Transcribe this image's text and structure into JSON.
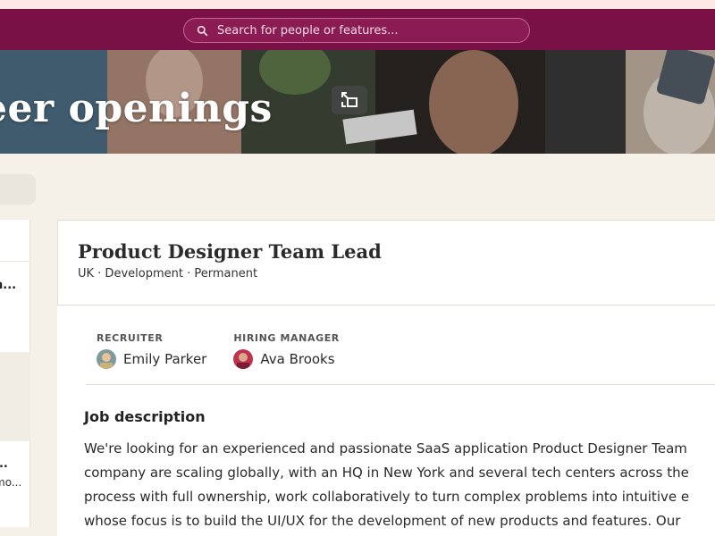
{
  "search": {
    "placeholder": "Search for people or features..."
  },
  "hero": {
    "title": "eer openings"
  },
  "left_list": {
    "items": [
      {
        "title": "t",
        "subtitle": ""
      },
      {
        "title": "n...",
        "subtitle": ""
      },
      {
        "title": "...",
        "subtitle": "mo..."
      }
    ]
  },
  "job": {
    "title": "Product Designer Team Lead",
    "meta": "UK · Development · Permanent",
    "recruiter_label": "RECRUITER",
    "recruiter_name": "Emily Parker",
    "hiring_manager_label": "HIRING MANAGER",
    "hiring_manager_name": "Ava Brooks",
    "description_heading": "Job description",
    "description_lines": [
      "We're looking for an experienced and passionate SaaS application Product Designer Team",
      "company are scaling globally, with an HQ in New York and several tech centers across the",
      "process with full ownership, work collaboratively to turn complex problems into intuitive e",
      "whose focus is to build the UI/UX for the development of new products and features. Our"
    ]
  },
  "icons": {
    "search": "search-icon",
    "expand": "expand-icon"
  },
  "colors": {
    "topbar": "#7a1146",
    "background": "#f6f1e8"
  }
}
